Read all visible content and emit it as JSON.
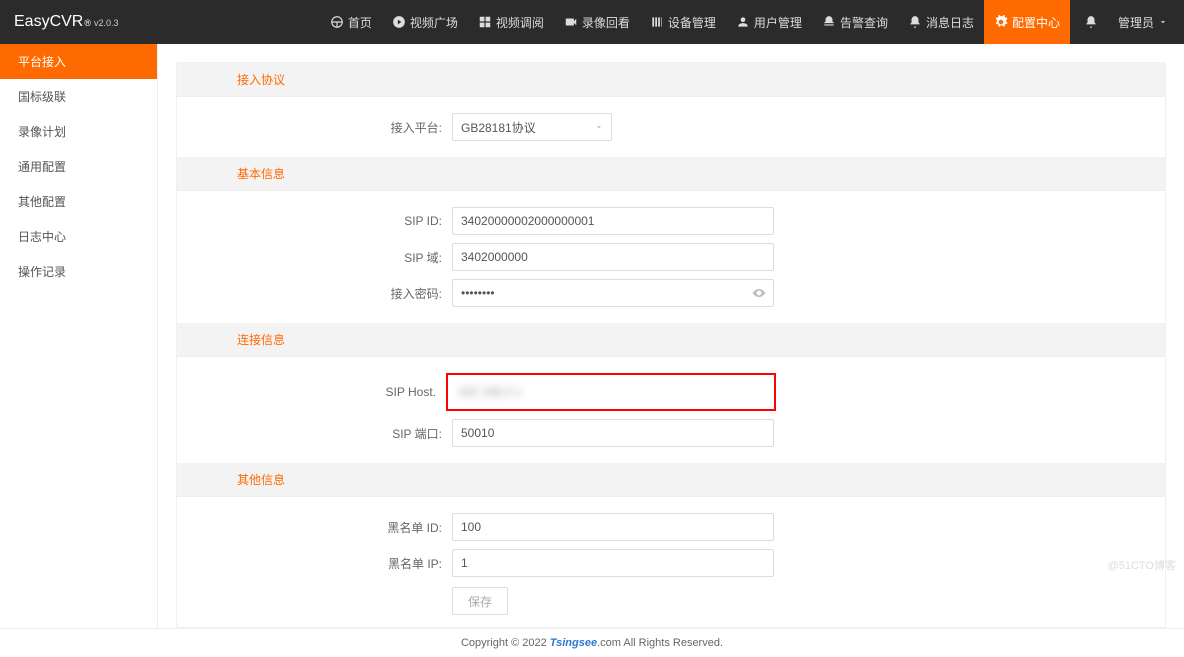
{
  "brand": {
    "name": "EasyCVR",
    "reg": "®",
    "version": "v2.0.3"
  },
  "nav": [
    {
      "key": "home",
      "label": "首页",
      "icon": "dashboard"
    },
    {
      "key": "video-square",
      "label": "视频广场",
      "icon": "play"
    },
    {
      "key": "video-preview",
      "label": "视频调阅",
      "icon": "grid"
    },
    {
      "key": "playback",
      "label": "录像回看",
      "icon": "camera"
    },
    {
      "key": "device-mgmt",
      "label": "设备管理",
      "icon": "bars"
    },
    {
      "key": "user-mgmt",
      "label": "用户管理",
      "icon": "user"
    },
    {
      "key": "alarm-query",
      "label": "告警查询",
      "icon": "alarm"
    },
    {
      "key": "msg-log",
      "label": "消息日志",
      "icon": "bell"
    },
    {
      "key": "config-center",
      "label": "配置中心",
      "icon": "gear",
      "active": true
    }
  ],
  "admin_label": "管理员",
  "sidebar": {
    "items": [
      {
        "key": "platform-access",
        "label": "平台接入",
        "active": true
      },
      {
        "key": "gb-cascade",
        "label": "国标级联"
      },
      {
        "key": "record-plan",
        "label": "录像计划"
      },
      {
        "key": "general-config",
        "label": "通用配置"
      },
      {
        "key": "other-config",
        "label": "其他配置"
      },
      {
        "key": "log-center",
        "label": "日志中心"
      },
      {
        "key": "op-record",
        "label": "操作记录"
      }
    ]
  },
  "sections": {
    "protocol": {
      "title": "接入协议",
      "platform_label": "接入平台:",
      "platform_value": "GB28181协议"
    },
    "basic": {
      "title": "基本信息",
      "sip_id_label": "SIP ID:",
      "sip_id_value": "34020000002000000001",
      "sip_realm_label": "SIP 域:",
      "sip_realm_value": "3402000000",
      "password_label": "接入密码:",
      "password_value": "••••••••"
    },
    "connect": {
      "title": "连接信息",
      "sip_host_label": "SIP Host.",
      "sip_host_value": "192 168 0 1",
      "sip_port_label": "SIP 端口:",
      "sip_port_value": "50010"
    },
    "other": {
      "title": "其他信息",
      "blacklist_id_label": "黑名单 ID:",
      "blacklist_id_value": "100",
      "blacklist_ip_label": "黑名单 IP:",
      "blacklist_ip_value": "1",
      "save_label": "保存"
    }
  },
  "footer": {
    "copyright_prefix": "Copyright © 2022 ",
    "brand": "Tsingsee",
    "suffix": ".com All Rights Reserved."
  },
  "watermark": "@51CTO博客"
}
